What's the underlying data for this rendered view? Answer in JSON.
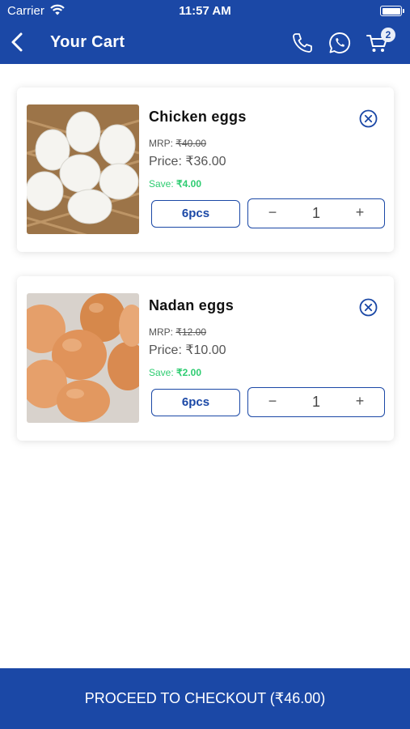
{
  "status_bar": {
    "carrier": "Carrier",
    "time": "11:57 AM"
  },
  "header": {
    "title": "Your Cart",
    "cart_count": "2",
    "icons": [
      "back-arrow-icon",
      "phone-icon",
      "whatsapp-icon",
      "cart-icon"
    ]
  },
  "colors": {
    "brand": "#1b48a6",
    "save_green": "#2ecc71"
  },
  "cart_items": [
    {
      "name": "Chicken eggs",
      "mrp_label": "MRP:",
      "mrp_value": "₹40.00",
      "price": "Price: ₹36.00",
      "save_label": "Save:",
      "save_value": "₹4.00",
      "unit": "6pcs",
      "quantity": "1",
      "minus": "−",
      "plus": "+"
    },
    {
      "name": "Nadan eggs",
      "mrp_label": "MRP:",
      "mrp_value": "₹12.00",
      "price": "Price: ₹10.00",
      "save_label": "Save:",
      "save_value": "₹2.00",
      "unit": "6pcs",
      "quantity": "1",
      "minus": "−",
      "plus": "+"
    }
  ],
  "checkout": {
    "label": "PROCEED TO CHECKOUT (₹46.00)"
  }
}
